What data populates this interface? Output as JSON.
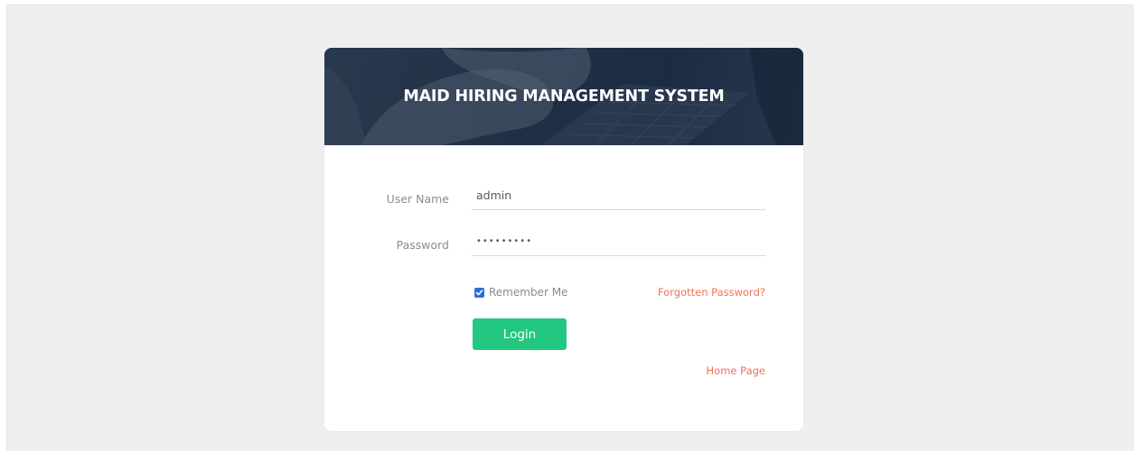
{
  "header": {
    "title": "MAID HIRING MANAGEMENT SYSTEM"
  },
  "form": {
    "username_label": "User Name",
    "username_value": "admin",
    "password_label": "Password",
    "password_value": "•••••••••",
    "remember_label": "Remember Me",
    "remember_checked": true,
    "forgot_link": "Forgotten Password?",
    "login_button": "Login",
    "home_link": "Home Page"
  },
  "colors": {
    "page_background": "#efefef",
    "card_background": "#ffffff",
    "header_background": "#2b3b50",
    "button_green": "#23c880",
    "link_orange": "#f1715a",
    "checkbox_blue": "#2b6fd6",
    "label_gray": "#888c90"
  },
  "icons": {
    "checkbox": "checkbox-checked-icon"
  }
}
